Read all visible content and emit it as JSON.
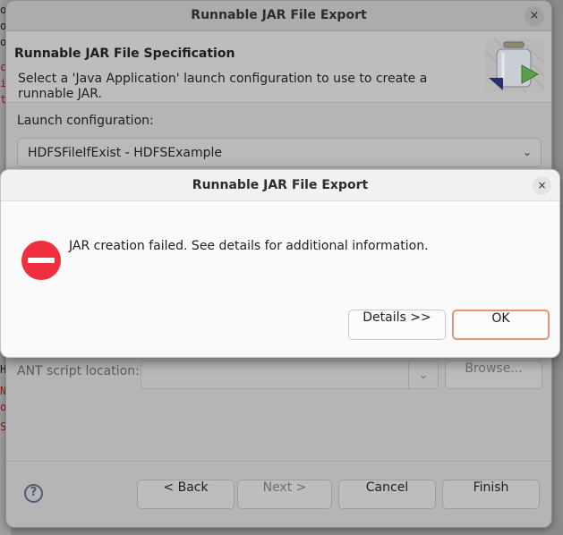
{
  "main_window": {
    "title": "Runnable JAR File Export",
    "close_glyph": "×",
    "header": {
      "title": "Runnable JAR File Specification",
      "description": "Select a 'Java Application' launch configuration to use to create a runnable JAR.",
      "icon": "jar-wizard-icon"
    },
    "launch_configuration": {
      "label": "Launch configuration:",
      "value": "HDFSFileIfExist - HDFSExample",
      "chevron": "⌄"
    },
    "ant_script": {
      "label": "ANT script location:",
      "value": "",
      "chevron": "⌄",
      "browse_label": "Browse..."
    },
    "footer": {
      "help_glyph": "?",
      "back_label": "< Back",
      "next_label": "Next >",
      "cancel_label": "Cancel",
      "finish_label": "Finish"
    }
  },
  "error_dialog": {
    "title": "Runnable JAR File Export",
    "close_glyph": "×",
    "icon": "error-icon",
    "message": "JAR creation failed. See details for additional information.",
    "details_label": "Details >>",
    "ok_label": "OK",
    "accent_color": "#e6937a",
    "error_color": "#ef2f3e"
  },
  "ide_background": {
    "fragments": [
      {
        "text": "or",
        "style": "normal"
      },
      {
        "text": "or",
        "style": "normal"
      },
      {
        "text": "or",
        "style": "normal"
      },
      {
        "text": "ct",
        "style": "red"
      },
      {
        "text": "i",
        "style": "red"
      },
      {
        "text": "t",
        "style": "red"
      },
      {
        "text": "H",
        "style": "normal"
      },
      {
        "text": "N",
        "style": "red"
      },
      {
        "text": "o",
        "style": "red"
      },
      {
        "text": "S",
        "style": "red"
      }
    ]
  }
}
